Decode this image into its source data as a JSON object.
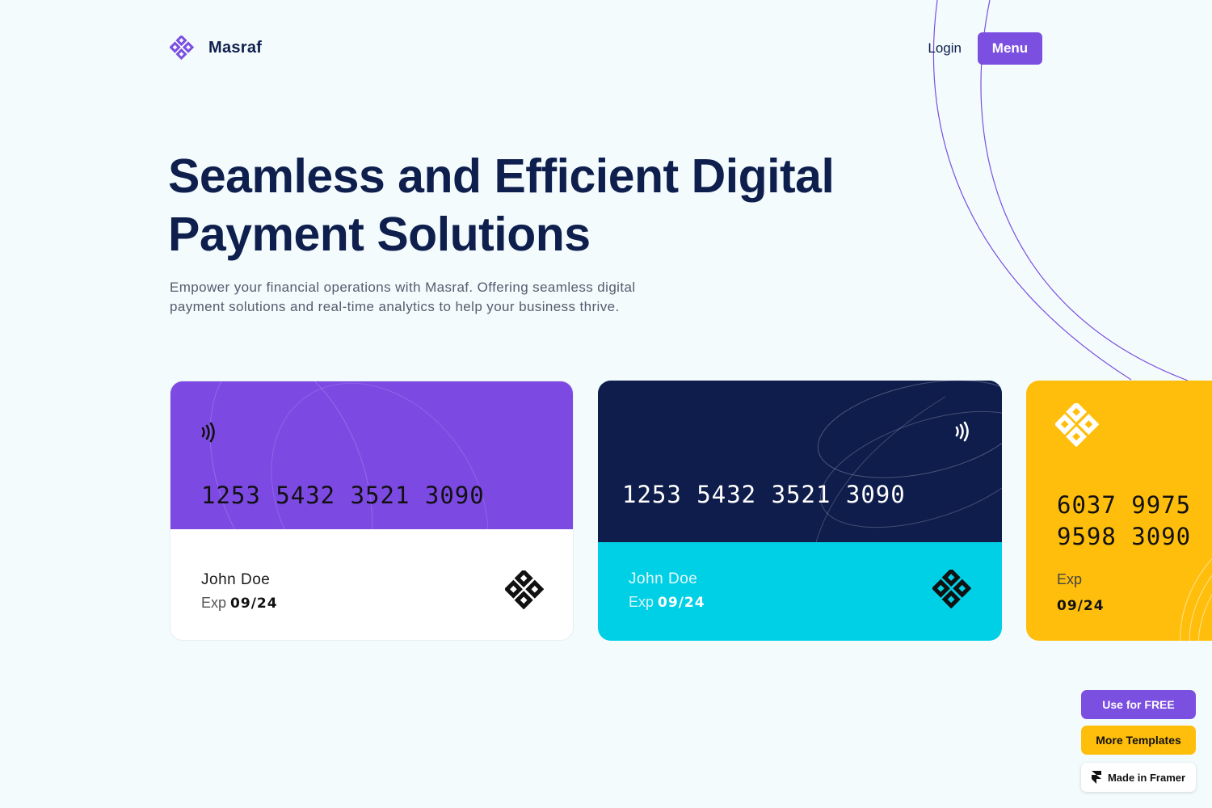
{
  "brand": {
    "name": "Masraf",
    "accent": "#7b4fe0",
    "logo_icon": "diamond-cluster-icon"
  },
  "nav": {
    "login_label": "Login",
    "menu_label": "Menu"
  },
  "hero": {
    "title_line1": "Seamless and Efficient Digital",
    "title_line2": "Payment Solutions",
    "subtitle_line1": "Empower your financial operations with Masraf. Offering seamless digital",
    "subtitle_line2": "payment solutions and real-time analytics to help your business thrive."
  },
  "cards": [
    {
      "number": "1253  5432  3521  3090",
      "name": "John Doe",
      "exp_label": "Exp",
      "exp_value": "09/24",
      "top_color": "#7d49e3",
      "bottom_color": "#ffffff",
      "contactless_icon": "contactless-icon",
      "logo_icon": "diamond-cluster-icon"
    },
    {
      "number": "1253  5432  3521  3090",
      "name": "John Doe",
      "exp_label": "Exp",
      "exp_value": "09/24",
      "top_color": "#0f1d4c",
      "bottom_color": "#00d0e6",
      "contactless_icon": "contactless-icon",
      "logo_icon": "diamond-cluster-icon"
    },
    {
      "number_line1": "6037 9975",
      "number_line2": "9598 3090",
      "exp_label": "Exp",
      "exp_value": "09/24",
      "color": "#ffbe0b",
      "logo_icon": "diamond-cluster-icon"
    }
  ],
  "floating": {
    "use_free_label": "Use for FREE",
    "more_templates_label": "More Templates",
    "made_in_framer_label": "Made in Framer"
  }
}
